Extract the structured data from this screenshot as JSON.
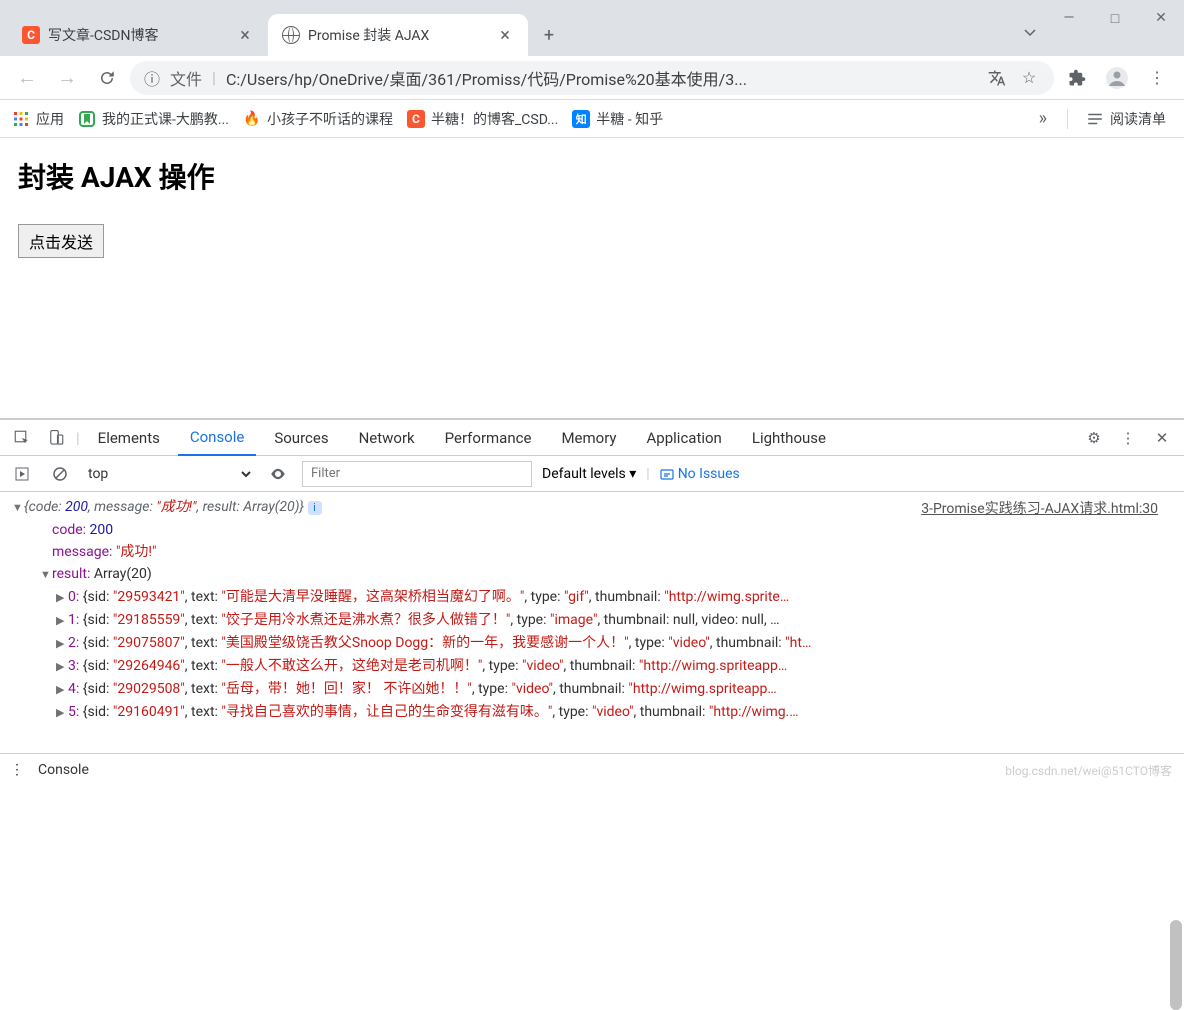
{
  "window": {
    "minimize": "—",
    "maximize": "□",
    "close": "✕"
  },
  "tabs": [
    {
      "title": "写文章-CSDN博客",
      "favicon": "C"
    },
    {
      "title": "Promise 封装 AJAX",
      "favicon": "globe"
    }
  ],
  "toolbar": {
    "file_label": "文件",
    "url": "C:/Users/hp/OneDrive/桌面/361/Promiss/代码/Promise%20基本使用/3..."
  },
  "bookmarks": {
    "apps": "应用",
    "items": [
      {
        "label": "我的正式课-大鹏教...",
        "icon": "green"
      },
      {
        "label": "小孩子不听话的课程",
        "icon": "flame"
      },
      {
        "label": "半糖！的博客_CSD...",
        "icon": "csdn"
      },
      {
        "label": "半糖 - 知乎",
        "icon": "zhihu"
      }
    ],
    "overflow": "»",
    "reading_list": "阅读清单"
  },
  "page": {
    "heading": "封装 AJAX 操作",
    "button": "点击发送"
  },
  "devtools": {
    "tabs": [
      "Elements",
      "Console",
      "Sources",
      "Network",
      "Performance",
      "Memory",
      "Application",
      "Lighthouse"
    ],
    "active_tab": "Console",
    "context": "top",
    "filter_placeholder": "Filter",
    "levels": "Default levels ▾",
    "no_issues": "No Issues",
    "source_link": "3-Promise实践练习-AJAX请求.html:30",
    "drawer": "Console"
  },
  "console_data": {
    "summary": {
      "code": 200,
      "message": "成功!",
      "result_label": "Array(20)"
    },
    "code_label": "code:",
    "code_val": "200",
    "message_label": "message:",
    "message_val": "\"成功!\"",
    "result_label": "result:",
    "result_val": "Array(20)",
    "rows": [
      {
        "idx": "0",
        "sid": "29593421",
        "text": "可能是大清早没睡醒，这高架桥相当魔幻了啊。",
        "type": "gif",
        "thumb": "\"http://wimg.sprite…"
      },
      {
        "idx": "1",
        "sid": "29185559",
        "text": "饺子是用冷水煮还是沸水煮？很多人做错了！",
        "type": "image",
        "thumb": "null, video: null, …"
      },
      {
        "idx": "2",
        "sid": "29075807",
        "text": "美国殿堂级饶舌教父Snoop Dogg：新的一年，我要感谢一个人！",
        "type": "video",
        "thumb": "\"ht…"
      },
      {
        "idx": "3",
        "sid": "29264946",
        "text": "一般人不敢这么开，这绝对是老司机啊！",
        "type": "video",
        "thumb": "\"http://wimg.spriteapp…"
      },
      {
        "idx": "4",
        "sid": "29029508",
        "text": "岳母，带！她！回！家！ 不许凶她！！",
        "type": "video",
        "thumb": "\"http://wimg.spriteapp…"
      },
      {
        "idx": "5",
        "sid": "29160491",
        "text": "寻找自己喜欢的事情，让自己的生命变得有滋有味。",
        "type": "video",
        "thumb": "\"http://wimg.…"
      }
    ]
  },
  "watermark": "blog.csdn.net/wei@51CTO博客"
}
